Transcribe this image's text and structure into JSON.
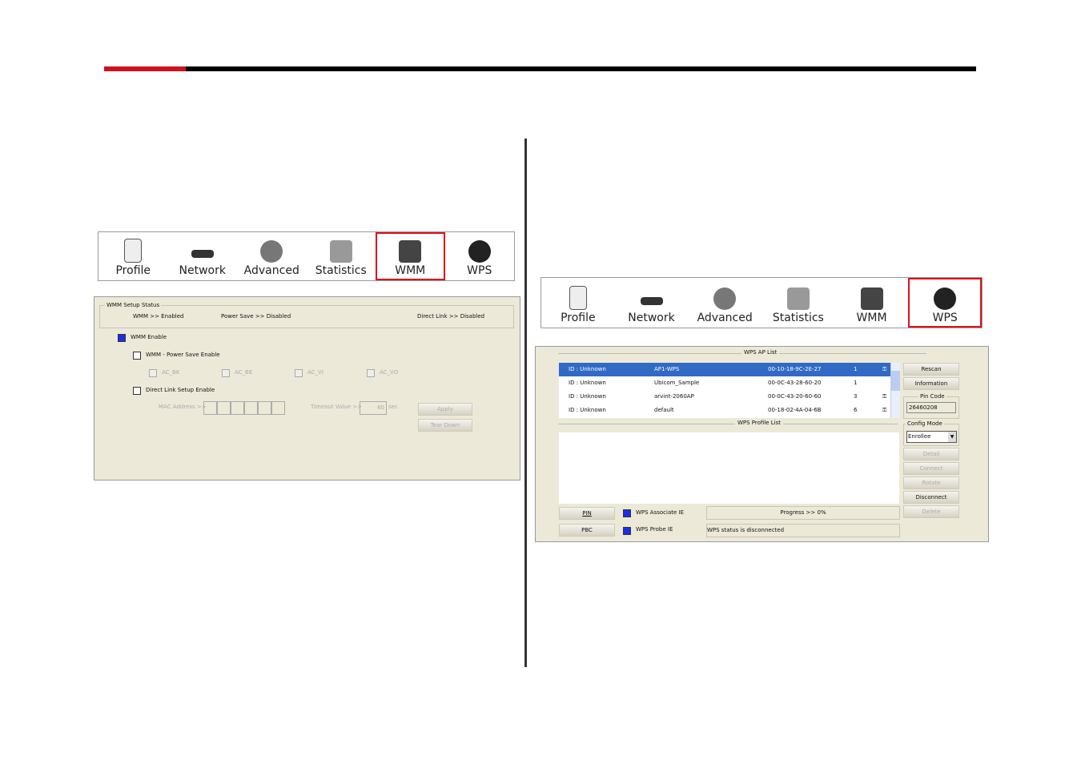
{
  "tabs": [
    "Profile",
    "Network",
    "Advanced",
    "Statistics",
    "WMM",
    "WPS"
  ],
  "left_toolbar": {
    "selected": "WMM"
  },
  "right_toolbar": {
    "selected": "WPS"
  },
  "wmm": {
    "status_title": "WMM Setup Status",
    "wmm_status": "WMM >> Enabled",
    "power_save_status": "Power Save >> Disabled",
    "direct_link_status": "Direct Link >> Disabled",
    "wmm_enable": "WMM Enable",
    "power_save_enable": "WMM - Power Save Enable",
    "ac": [
      "AC_BK",
      "AC_BE",
      "AC_VI",
      "AC_VO"
    ],
    "dls_enable": "Direct Link Setup Enable",
    "mac_label": "MAC Address >>",
    "timeout_label": "Timeout Value >>",
    "timeout_value": "60",
    "timeout_unit": "sec",
    "apply": "Apply",
    "tear_down": "Tear Down"
  },
  "wps": {
    "ap_list_title": "WPS AP List",
    "ap_list": [
      {
        "id": "ID : Unknown",
        "ssid": "AP1-WPS",
        "mac": "00-10-18-9C-2E-27",
        "ch": "1",
        "lock": true
      },
      {
        "id": "ID : Unknown",
        "ssid": "Ubicom_Sample",
        "mac": "00-0C-43-28-60-20",
        "ch": "1",
        "lock": false
      },
      {
        "id": "ID : Unknown",
        "ssid": "arvint-2060AP",
        "mac": "00-0C-43-20-60-60",
        "ch": "3",
        "lock": true
      },
      {
        "id": "ID : Unknown",
        "ssid": "default",
        "mac": "00-18-02-4A-04-6B",
        "ch": "6",
        "lock": true
      }
    ],
    "profile_list_title": "WPS Profile List",
    "rescan": "Rescan",
    "information": "Information",
    "pin_code_label": "Pin Code",
    "pin_code": "26460208",
    "config_mode_label": "Config Mode",
    "config_mode": "Enrollee",
    "detail": "Detail",
    "connect": "Connect",
    "rotate": "Rotate",
    "disconnect": "Disconnect",
    "delete": "Delete",
    "pin": "PIN",
    "pbc": "PBC",
    "associate_ie": "WPS Associate IE",
    "probe_ie": "WPS Probe IE",
    "progress": "Progress >> 0%",
    "progress_value": 0,
    "status": "WPS status is disconnected"
  },
  "colors": {
    "accent_red": "#d0101c",
    "selection": "#316ac5",
    "panel": "#ece9d8"
  }
}
